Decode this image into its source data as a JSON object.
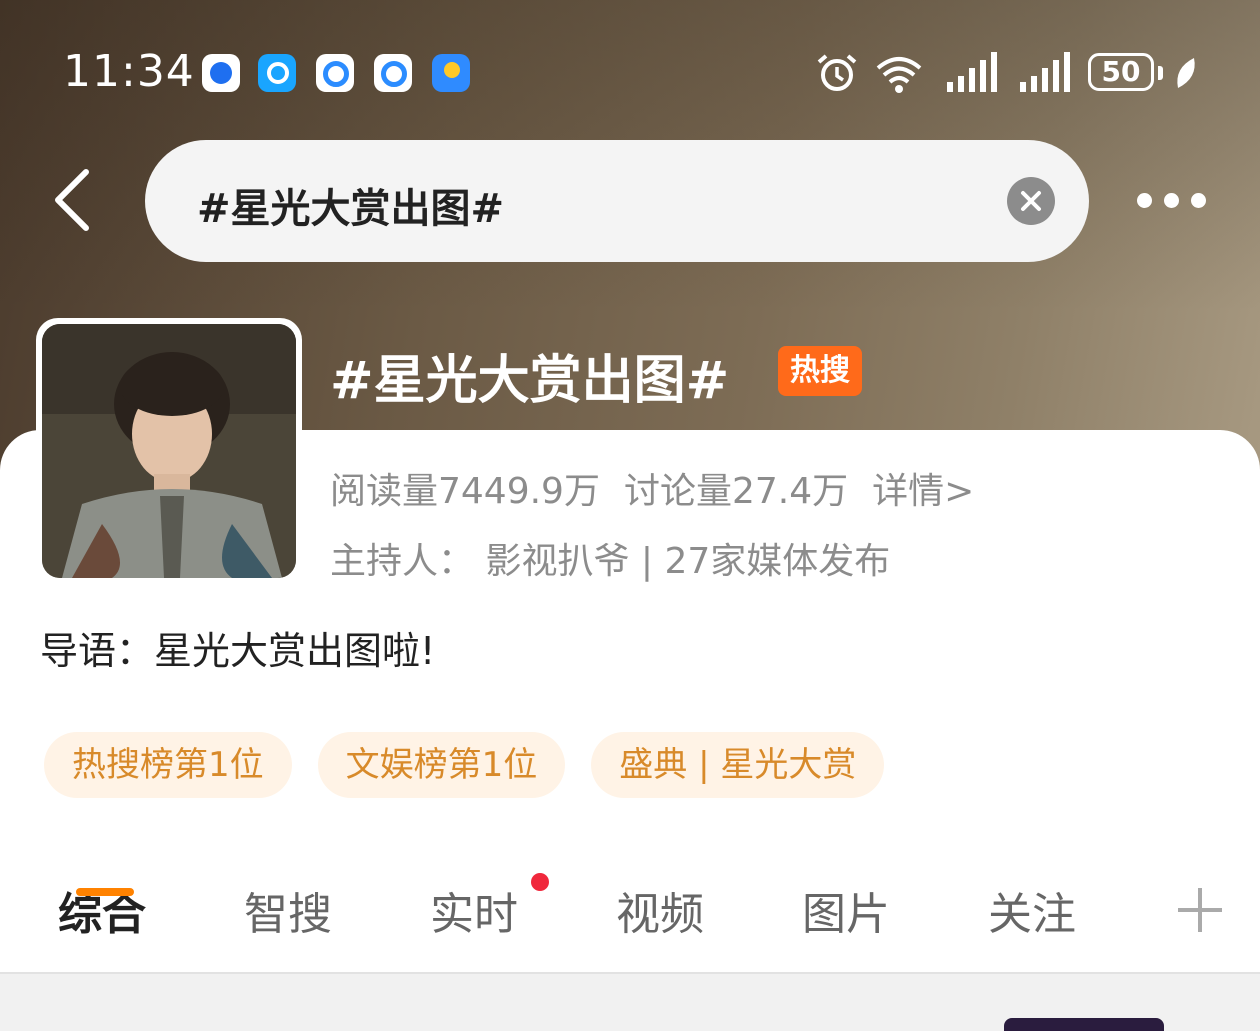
{
  "status_bar": {
    "time": "11:34",
    "battery": "50",
    "apps": [
      "browser-app-icon",
      "search-app-icon",
      "qq-browser-icon",
      "qq-browser-icon-2",
      "weather-app-icon"
    ]
  },
  "search": {
    "query": "#星光大赏出图#"
  },
  "topic": {
    "title": "#星光大赏出图#",
    "badge": "热搜",
    "reads": "阅读量7449.9万",
    "discussions": "讨论量27.4万",
    "details": "详情>",
    "host": "主持人：  影视扒爷 | 27家媒体发布",
    "intro": "导语：星光大赏出图啦!"
  },
  "tags": [
    {
      "label": "热搜榜第1位"
    },
    {
      "label": "文娱榜第1位"
    },
    {
      "label": "盛典 | 星光大赏"
    }
  ],
  "tabs": [
    {
      "label": "综合"
    },
    {
      "label": "智搜"
    },
    {
      "label": "实时"
    },
    {
      "label": "视频"
    },
    {
      "label": "图片"
    },
    {
      "label": "关注"
    }
  ],
  "colors": {
    "accent": "#ff8200",
    "hot_badge": "#ff6a1a",
    "tag_text": "#d88a2a",
    "tag_bg": "#fff3e6",
    "red_dot": "#f0283c"
  }
}
